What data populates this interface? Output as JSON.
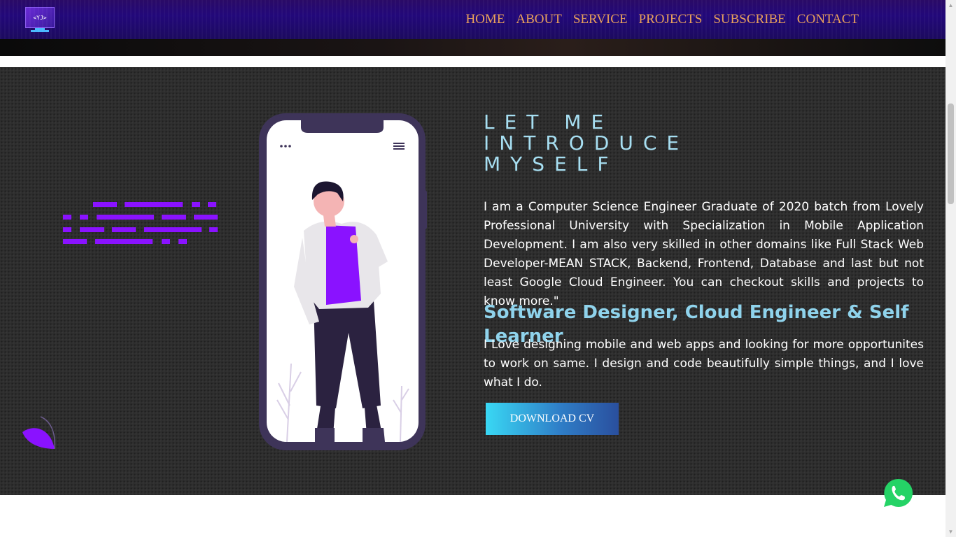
{
  "navbar": {
    "logo_text": "<YJ>",
    "items": [
      {
        "label": "HOME"
      },
      {
        "label": "ABOUT"
      },
      {
        "label": "SERVICE"
      },
      {
        "label": "PROJECTS"
      },
      {
        "label": "SUBSCRIBE"
      },
      {
        "label": "CONTACT"
      }
    ]
  },
  "about": {
    "title_lines": [
      "LET ME",
      "INTRODUCE",
      "MYSELF"
    ],
    "paragraph1": "I am a Computer Science Engineer Graduate of 2020 batch from Lovely Professional University with Specialization in Mobile Application Development. I am also very skilled in other domains like Full Stack Web Developer-MEAN STACK, Backend, Frontend, Database and last but not least Google Cloud Engineer. You can checkout skills and projects to know more.\"",
    "role_heading": "Software Designer, Cloud Engineer & Self Learner",
    "paragraph2": "I Love designing mobile and web apps and looking for more opportunites to work on same. I design and code beautifully simple things, and I love what I do.",
    "download_label": "DOWNLOAD CV"
  },
  "icons": {
    "whatsapp": "whatsapp-icon",
    "phone_menu": "hamburger-icon",
    "phone_dots": "more-dots-icon"
  },
  "colors": {
    "nav_link": "#e8a05a",
    "title": "#a7dff2",
    "accent_purple": "#8a12ff",
    "whatsapp": "#25d366"
  }
}
